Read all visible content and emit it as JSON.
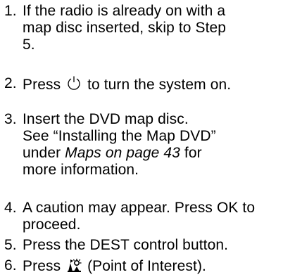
{
  "steps": [
    {
      "number": "1.",
      "text": "If the radio is already on with a map disc inserted, skip to Step 5."
    },
    {
      "number": "2.",
      "before": "Press",
      "icon": "power-icon",
      "after": "to turn the system on."
    },
    {
      "number": "3.",
      "line1": "Insert the DVD map disc.",
      "line2": "See “Installing the Map DVD”",
      "line3_before": "under",
      "line3_italic": "Maps on page 43",
      "line3_after": "for",
      "line4": "more information."
    },
    {
      "number": "4.",
      "text": "A caution may appear. Press OK to proceed."
    },
    {
      "number": "5.",
      "text": "Press the DEST control button."
    },
    {
      "number": "6.",
      "before": "Press",
      "icon": "point-of-interest-icon",
      "after": "(Point of Interest)."
    }
  ]
}
